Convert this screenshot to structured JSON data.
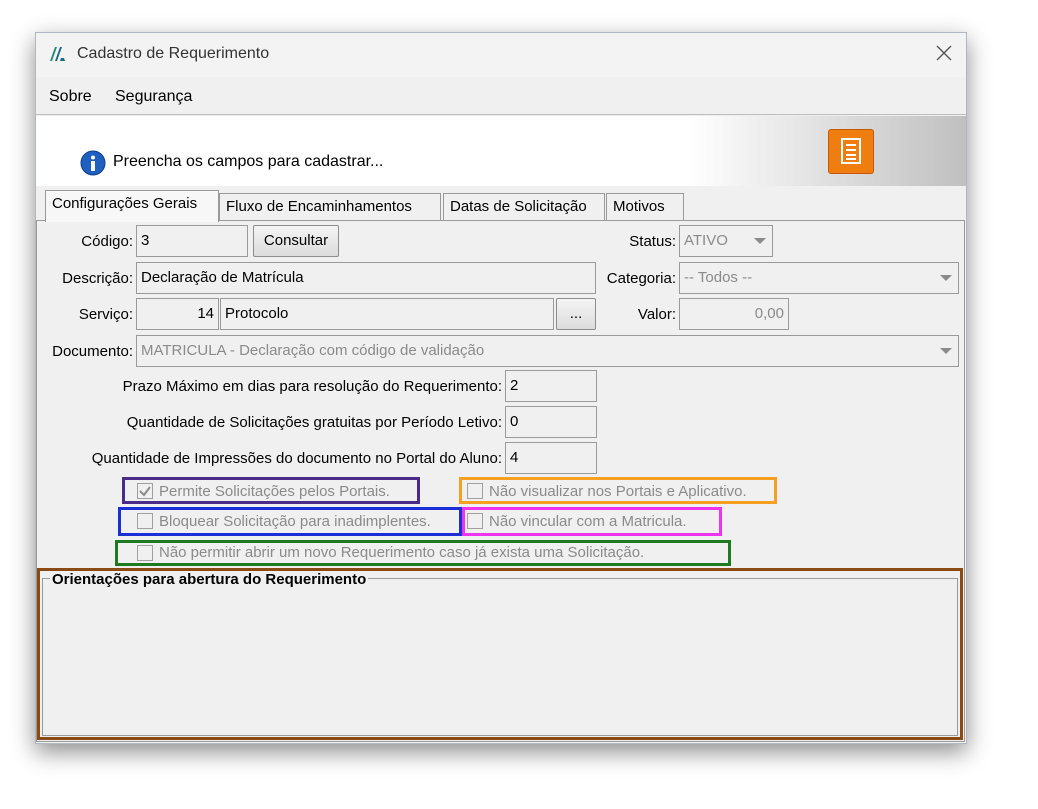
{
  "window": {
    "title": "Cadastro de Requerimento"
  },
  "menu": {
    "items": [
      "Sobre",
      "Segurança"
    ]
  },
  "banner": {
    "message": "Preencha os campos para cadastrar..."
  },
  "tabs": [
    "Configurações Gerais",
    "Fluxo de Encaminhamentos",
    "Datas de Solicitação",
    "Motivos"
  ],
  "form": {
    "codigo": {
      "label": "Código:",
      "value": "3",
      "button": "Consultar"
    },
    "status": {
      "label": "Status:",
      "value": "ATIVO"
    },
    "descricao": {
      "label": "Descrição:",
      "value": "Declaração de Matrícula"
    },
    "categoria": {
      "label": "Categoria:",
      "value": "-- Todos --"
    },
    "servico": {
      "label": "Serviço:",
      "code": "14",
      "name": "Protocolo",
      "button": "..."
    },
    "valor": {
      "label": "Valor:",
      "value": "0,00"
    },
    "documento": {
      "label": "Documento:",
      "value": "MATRICULA - Declaração com código de validação"
    },
    "prazo": {
      "label": "Prazo Máximo em dias para resolução do Requerimento:",
      "value": "2"
    },
    "solicitacoes": {
      "label": "Quantidade de Solicitações gratuitas por Período Letivo:",
      "value": "0"
    },
    "impressoes": {
      "label": "Quantidade de Impressões do documento no Portal do Aluno:",
      "value": "4"
    }
  },
  "checkboxes": {
    "permite_portais": {
      "label": "Permite Solicitações pelos Portais.",
      "checked": true
    },
    "nao_visualizar": {
      "label": "Não visualizar nos Portais e Aplicativo.",
      "checked": false
    },
    "bloquear": {
      "label": "Bloquear Solicitação para inadimplentes.",
      "checked": false
    },
    "nao_vincular": {
      "label": "Não vincular com a Matricula.",
      "checked": false
    },
    "nao_permitir": {
      "label": "Não permitir abrir um novo Requerimento caso já exista uma Solicitação.",
      "checked": false
    }
  },
  "orientacoes": {
    "title": "Orientações para abertura do Requerimento"
  },
  "colors": {
    "highlight_purple": "#4b2a8a",
    "highlight_orange": "#f5a020",
    "highlight_blue": "#1a2fd6",
    "highlight_magenta": "#ee33ee",
    "highlight_green": "#1e7a1e",
    "highlight_brown": "#8b4a12",
    "accent_orange": "#f07d10",
    "info_blue": "#1e5fc0"
  }
}
